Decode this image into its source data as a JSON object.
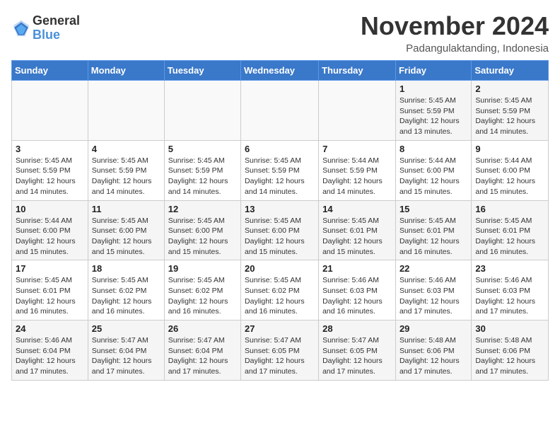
{
  "logo": {
    "general": "General",
    "blue": "Blue"
  },
  "title": "November 2024",
  "location": "Padangulaktanding, Indonesia",
  "days_of_week": [
    "Sunday",
    "Monday",
    "Tuesday",
    "Wednesday",
    "Thursday",
    "Friday",
    "Saturday"
  ],
  "weeks": [
    [
      {
        "day": "",
        "info": ""
      },
      {
        "day": "",
        "info": ""
      },
      {
        "day": "",
        "info": ""
      },
      {
        "day": "",
        "info": ""
      },
      {
        "day": "",
        "info": ""
      },
      {
        "day": "1",
        "info": "Sunrise: 5:45 AM\nSunset: 5:59 PM\nDaylight: 12 hours\nand 13 minutes."
      },
      {
        "day": "2",
        "info": "Sunrise: 5:45 AM\nSunset: 5:59 PM\nDaylight: 12 hours\nand 14 minutes."
      }
    ],
    [
      {
        "day": "3",
        "info": "Sunrise: 5:45 AM\nSunset: 5:59 PM\nDaylight: 12 hours\nand 14 minutes."
      },
      {
        "day": "4",
        "info": "Sunrise: 5:45 AM\nSunset: 5:59 PM\nDaylight: 12 hours\nand 14 minutes."
      },
      {
        "day": "5",
        "info": "Sunrise: 5:45 AM\nSunset: 5:59 PM\nDaylight: 12 hours\nand 14 minutes."
      },
      {
        "day": "6",
        "info": "Sunrise: 5:45 AM\nSunset: 5:59 PM\nDaylight: 12 hours\nand 14 minutes."
      },
      {
        "day": "7",
        "info": "Sunrise: 5:44 AM\nSunset: 5:59 PM\nDaylight: 12 hours\nand 14 minutes."
      },
      {
        "day": "8",
        "info": "Sunrise: 5:44 AM\nSunset: 6:00 PM\nDaylight: 12 hours\nand 15 minutes."
      },
      {
        "day": "9",
        "info": "Sunrise: 5:44 AM\nSunset: 6:00 PM\nDaylight: 12 hours\nand 15 minutes."
      }
    ],
    [
      {
        "day": "10",
        "info": "Sunrise: 5:44 AM\nSunset: 6:00 PM\nDaylight: 12 hours\nand 15 minutes."
      },
      {
        "day": "11",
        "info": "Sunrise: 5:45 AM\nSunset: 6:00 PM\nDaylight: 12 hours\nand 15 minutes."
      },
      {
        "day": "12",
        "info": "Sunrise: 5:45 AM\nSunset: 6:00 PM\nDaylight: 12 hours\nand 15 minutes."
      },
      {
        "day": "13",
        "info": "Sunrise: 5:45 AM\nSunset: 6:00 PM\nDaylight: 12 hours\nand 15 minutes."
      },
      {
        "day": "14",
        "info": "Sunrise: 5:45 AM\nSunset: 6:01 PM\nDaylight: 12 hours\nand 15 minutes."
      },
      {
        "day": "15",
        "info": "Sunrise: 5:45 AM\nSunset: 6:01 PM\nDaylight: 12 hours\nand 16 minutes."
      },
      {
        "day": "16",
        "info": "Sunrise: 5:45 AM\nSunset: 6:01 PM\nDaylight: 12 hours\nand 16 minutes."
      }
    ],
    [
      {
        "day": "17",
        "info": "Sunrise: 5:45 AM\nSunset: 6:01 PM\nDaylight: 12 hours\nand 16 minutes."
      },
      {
        "day": "18",
        "info": "Sunrise: 5:45 AM\nSunset: 6:02 PM\nDaylight: 12 hours\nand 16 minutes."
      },
      {
        "day": "19",
        "info": "Sunrise: 5:45 AM\nSunset: 6:02 PM\nDaylight: 12 hours\nand 16 minutes."
      },
      {
        "day": "20",
        "info": "Sunrise: 5:45 AM\nSunset: 6:02 PM\nDaylight: 12 hours\nand 16 minutes."
      },
      {
        "day": "21",
        "info": "Sunrise: 5:46 AM\nSunset: 6:03 PM\nDaylight: 12 hours\nand 16 minutes."
      },
      {
        "day": "22",
        "info": "Sunrise: 5:46 AM\nSunset: 6:03 PM\nDaylight: 12 hours\nand 17 minutes."
      },
      {
        "day": "23",
        "info": "Sunrise: 5:46 AM\nSunset: 6:03 PM\nDaylight: 12 hours\nand 17 minutes."
      }
    ],
    [
      {
        "day": "24",
        "info": "Sunrise: 5:46 AM\nSunset: 6:04 PM\nDaylight: 12 hours\nand 17 minutes."
      },
      {
        "day": "25",
        "info": "Sunrise: 5:47 AM\nSunset: 6:04 PM\nDaylight: 12 hours\nand 17 minutes."
      },
      {
        "day": "26",
        "info": "Sunrise: 5:47 AM\nSunset: 6:04 PM\nDaylight: 12 hours\nand 17 minutes."
      },
      {
        "day": "27",
        "info": "Sunrise: 5:47 AM\nSunset: 6:05 PM\nDaylight: 12 hours\nand 17 minutes."
      },
      {
        "day": "28",
        "info": "Sunrise: 5:47 AM\nSunset: 6:05 PM\nDaylight: 12 hours\nand 17 minutes."
      },
      {
        "day": "29",
        "info": "Sunrise: 5:48 AM\nSunset: 6:06 PM\nDaylight: 12 hours\nand 17 minutes."
      },
      {
        "day": "30",
        "info": "Sunrise: 5:48 AM\nSunset: 6:06 PM\nDaylight: 12 hours\nand 17 minutes."
      }
    ]
  ]
}
